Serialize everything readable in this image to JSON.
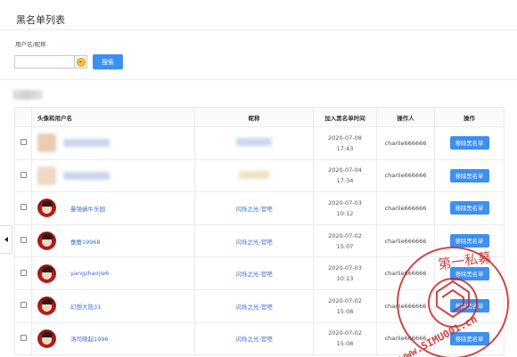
{
  "page": {
    "title": "黑名单列表"
  },
  "filter": {
    "label": "用户名/昵称",
    "input_value": "",
    "input_placeholder": "",
    "search_label": "搜索"
  },
  "table": {
    "headers": {
      "name": "头像和用户名",
      "nick": "昵称",
      "time": "加入黑名单时间",
      "operator": "操作人",
      "action": "操作"
    },
    "rows": [
      {
        "username": "",
        "nickname": "",
        "date": "2020-07-08",
        "clock": "17:43",
        "operator": "charlie666666",
        "action": "移除黑名单"
      },
      {
        "username": "",
        "nickname": "",
        "date": "2020-07-04",
        "clock": "17:34",
        "operator": "charlie666666",
        "action": "移除黑名单"
      },
      {
        "username": "曼强蜗牛乐园",
        "nickname": "闪烁之光-官吧",
        "date": "2020-07-03",
        "clock": "10:12",
        "operator": "charlie666666",
        "action": "移除黑名单"
      },
      {
        "username": "蚕蚕19968",
        "nickname": "闪烁之光-官吧",
        "date": "2020-07-02",
        "clock": "15:07",
        "operator": "charlie666666",
        "action": "移除黑名单"
      },
      {
        "username": "yangzhaojie6",
        "nickname": "闪烁之光-官吧",
        "date": "2020-07-03",
        "clock": "10:13",
        "operator": "charlie666666",
        "action": "移除黑名单"
      },
      {
        "username": "幻想大陆31",
        "nickname": "闪烁之光-官吧",
        "date": "2020-07-02",
        "clock": "15:08",
        "operator": "charlie666666",
        "action": "移除黑名单"
      },
      {
        "username": "涛司晓起1996",
        "nickname": "闪烁之光-官吧",
        "date": "2020-07-02",
        "clock": "15:08",
        "operator": "charlie666666",
        "action": "移除黑名单"
      }
    ]
  },
  "watermark": {
    "line1": "第一私募",
    "line2": "www.SIMU001.cn",
    "color": "#c62828"
  },
  "colors": {
    "primary": "#3d8ff0",
    "link": "#3a6fcf"
  }
}
